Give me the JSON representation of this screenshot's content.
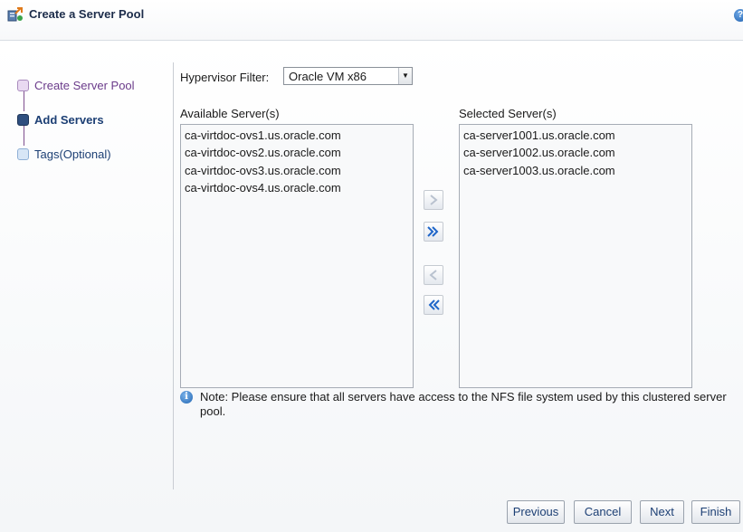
{
  "dialog": {
    "title": "Create a Server Pool",
    "help_icon": "question-icon",
    "help_glyph": "?"
  },
  "steps": [
    {
      "label": "Create Server Pool",
      "state": "visited"
    },
    {
      "label": "Add Servers",
      "state": "current"
    },
    {
      "label": "Tags(Optional)",
      "state": "unvisited"
    }
  ],
  "filter": {
    "label": "Hypervisor Filter:",
    "value": "Oracle VM x86"
  },
  "available": {
    "label": "Available Server(s)",
    "items": [
      "ca-virtdoc-ovs1.us.oracle.com",
      "ca-virtdoc-ovs2.us.oracle.com",
      "ca-virtdoc-ovs3.us.oracle.com",
      "ca-virtdoc-ovs4.us.oracle.com"
    ]
  },
  "selected": {
    "label": "Selected Server(s)",
    "items": [
      "ca-server1001.us.oracle.com",
      "ca-server1002.us.oracle.com",
      "ca-server1003.us.oracle.com"
    ]
  },
  "shuttle": {
    "move": "move-right-icon",
    "move_all": "move-all-right-icon",
    "remove": "move-left-icon",
    "remove_all": "move-all-left-icon"
  },
  "note": {
    "icon": "info-icon",
    "glyph": "i",
    "text": "Note: Please ensure that all servers have access to the NFS file system used by this clustered server pool."
  },
  "buttons": {
    "previous": "Previous",
    "cancel": "Cancel",
    "next": "Next",
    "finish": "Finish"
  },
  "colors": {
    "visited_step": "#6b3b8a",
    "current_step": "#1c3f74",
    "shuttle_active": "#1f66c9",
    "shuttle_disabled": "#b9c2cf"
  }
}
